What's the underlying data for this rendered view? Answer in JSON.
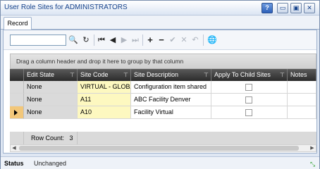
{
  "window": {
    "title": "User Role Sites for ADMINISTRATORS",
    "help_label": "?",
    "min_label": "▭",
    "max_label": "▣",
    "close_label": "✕"
  },
  "tabs": [
    {
      "label": "Record"
    }
  ],
  "toolbar": {
    "search_value": "",
    "search_placeholder": "",
    "icons": {
      "search": "🔍",
      "refresh": "↻",
      "first": "⏮",
      "prev": "◀",
      "next": "▶",
      "last": "⏭",
      "add": "+",
      "remove": "−",
      "save": "✔",
      "cancel": "✕",
      "undo": "↶",
      "globe": "🌐"
    }
  },
  "group_panel": {
    "text": "Drag a column header and drop it here to group by that column"
  },
  "grid": {
    "columns": [
      "Edit State",
      "Site Code",
      "Site Description",
      "Apply To Child Sites",
      "Notes"
    ],
    "rows": [
      {
        "edit_state": "None",
        "site_code": "VIRTUAL - GLOBAL",
        "site_description": "Configuration item shared",
        "apply_to_child": false,
        "notes": ""
      },
      {
        "edit_state": "None",
        "site_code": "A11",
        "site_description": "ABC Facility Denver",
        "apply_to_child": false,
        "notes": ""
      },
      {
        "edit_state": "None",
        "site_code": "A10",
        "site_description": "Facility Virtual",
        "apply_to_child": false,
        "notes": ""
      }
    ],
    "active_row": 2,
    "row_count_label": "Row Count:",
    "row_count": "3"
  },
  "statusbar": {
    "label": "Status",
    "value": "Unchanged"
  },
  "colors": {
    "header_bg": "#2b2b2b",
    "site_code_bg": "#fdf8c0",
    "active_indicator": "#f2c77a",
    "title_text": "#15428b"
  }
}
